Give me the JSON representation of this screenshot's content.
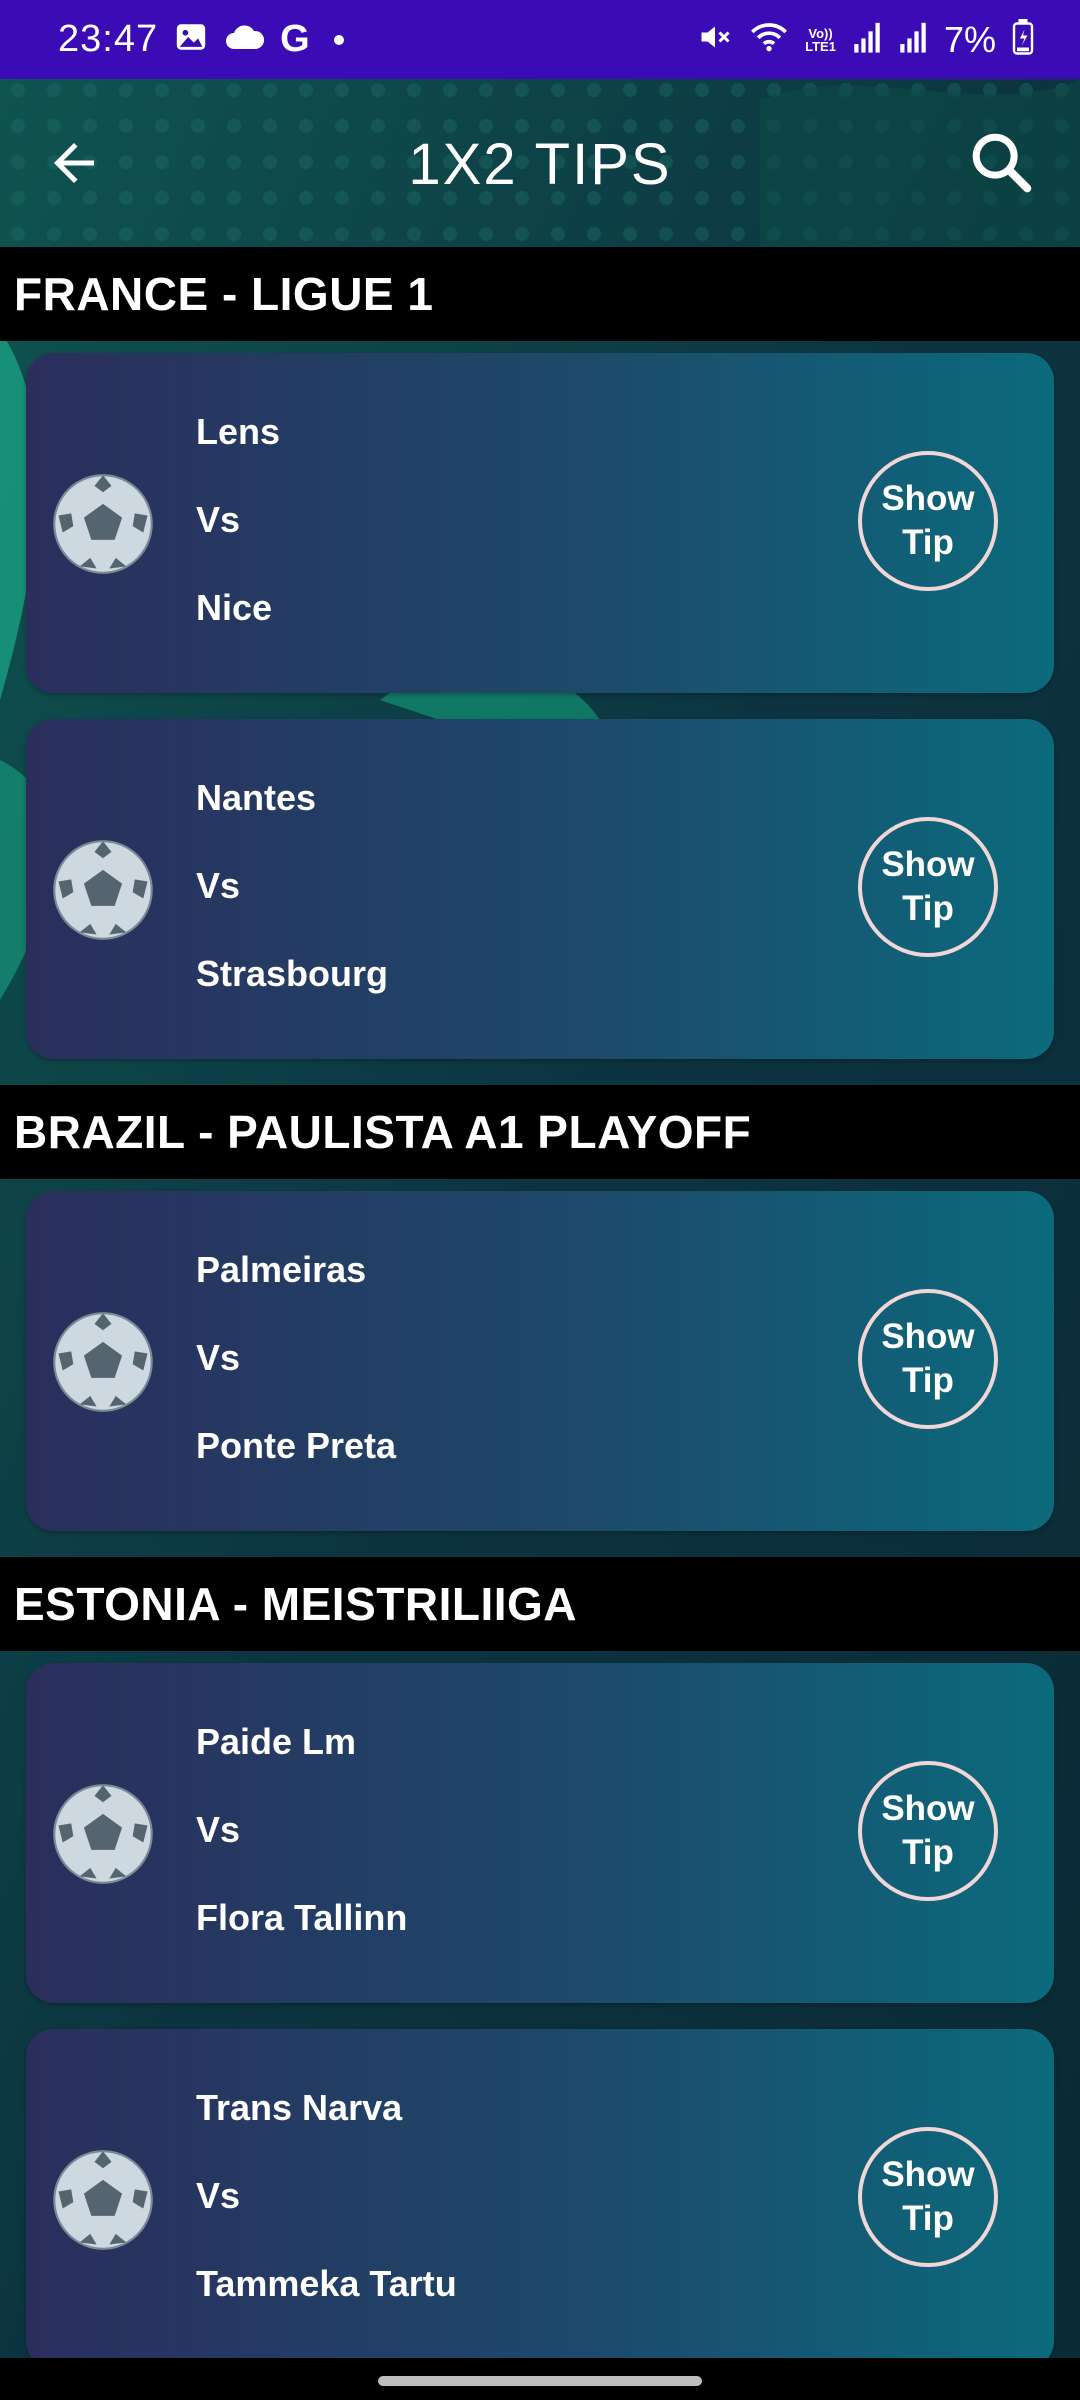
{
  "status_bar": {
    "time": "23:47",
    "left_icons": [
      "gallery-icon",
      "cloud-icon",
      "google-icon",
      "dot-icon"
    ],
    "google_letter": "G",
    "volte_top": "Vo))",
    "volte_bottom": "LTE1",
    "right_icons": [
      "mute-icon",
      "wifi-icon",
      "volte-icon",
      "signal-icon",
      "signal-icon",
      "battery-icon"
    ],
    "battery": "7%"
  },
  "app_bar": {
    "title": "1X2 TIPS",
    "back_icon": "arrow-left-icon",
    "search_icon": "search-icon"
  },
  "tip_label": {
    "line1": "Show",
    "line2": "Tip"
  },
  "vs_label": "Vs",
  "leagues": [
    {
      "name": "FRANCE - LIGUE 1",
      "matches": [
        {
          "home": "Lens",
          "away": "Nice"
        },
        {
          "home": "Nantes",
          "away": "Strasbourg"
        }
      ]
    },
    {
      "name": "BRAZIL - PAULISTA A1 PLAYOFF",
      "matches": [
        {
          "home": "Palmeiras",
          "away": "Ponte Preta"
        }
      ]
    },
    {
      "name": "ESTONIA - MEISTRILIIGA",
      "matches": [
        {
          "home": "Paide Lm",
          "away": "Flora Tallinn"
        },
        {
          "home": "Trans Narva",
          "away": "Tammeka Tartu"
        }
      ]
    }
  ],
  "colors": {
    "status_bar": "#3b0bb5",
    "card_start": "#2b2e5c",
    "card_end": "#0b6a7c",
    "tip_border": "#f0d6d6",
    "header_bg": "#000000"
  }
}
